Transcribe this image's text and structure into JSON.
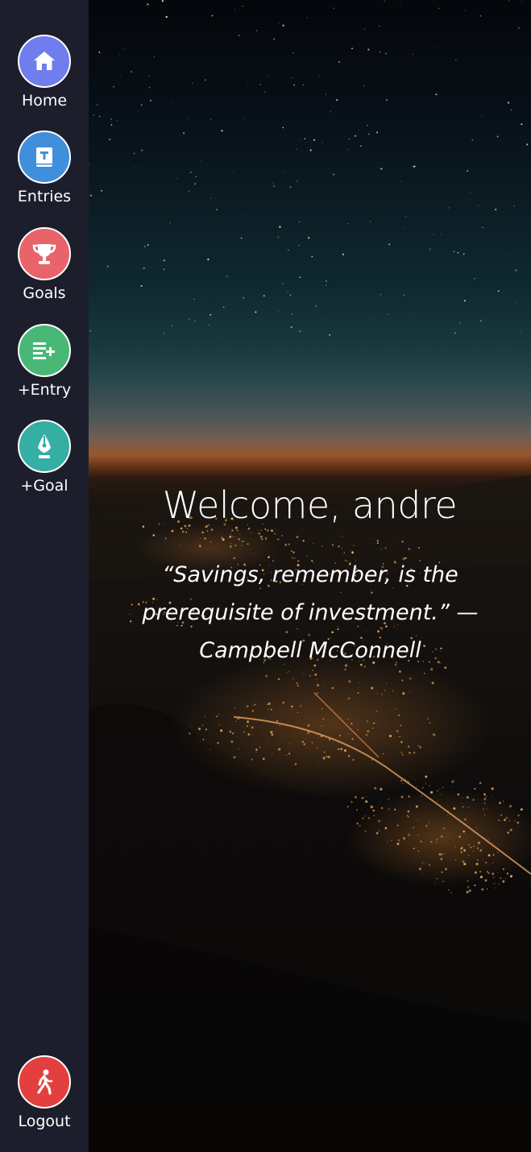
{
  "sidebar": {
    "items": [
      {
        "label": "Home",
        "icon": "home-icon",
        "color": "#6f7ded"
      },
      {
        "label": "Entries",
        "icon": "book-icon",
        "color": "#3f8fdc"
      },
      {
        "label": "Goals",
        "icon": "trophy-icon",
        "color": "#e8646a"
      },
      {
        "label": "+Entry",
        "icon": "add-list-icon",
        "color": "#49b877"
      },
      {
        "label": "+Goal",
        "icon": "pen-nib-icon",
        "color": "#35aea4"
      }
    ],
    "logout": {
      "label": "Logout",
      "icon": "walking-person-icon",
      "color": "#e43f3f"
    },
    "background": "#1c1f2b"
  },
  "main": {
    "welcome": "Welcome, andre",
    "quote": "“Savings, remember, is the prerequisite of investment.” — Campbell McConnell"
  }
}
